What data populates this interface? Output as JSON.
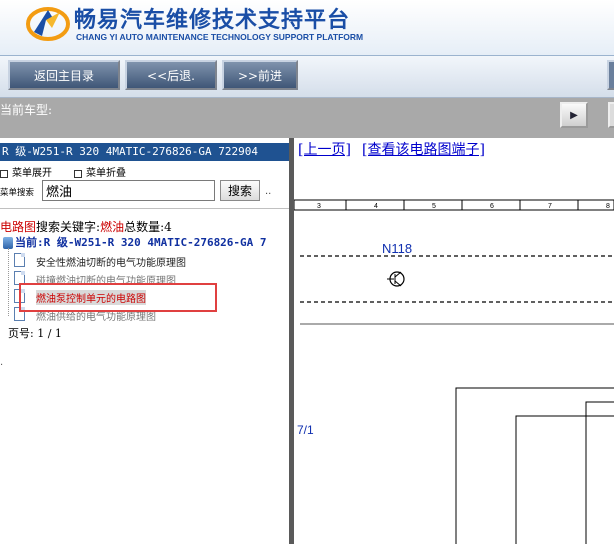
{
  "header": {
    "title_cn": "畅易汽车维修技术支持平台",
    "title_en": "CHANG YI AUTO MAINTENANCE TECHNOLOGY SUPPORT PLATFORM"
  },
  "toolbar": {
    "main_menu": "返回主目录",
    "back": "<<后退.",
    "forward": ">>前进"
  },
  "vehicle": {
    "label": "当前车型:"
  },
  "left": {
    "model": "R 级-W251-R 320 4MATIC-276826-GA 722904",
    "expand": "菜单展开",
    "collapse": "菜单折叠",
    "search_label": "菜单搜索",
    "search_value": "燃油",
    "search_button": "搜索",
    "search_more": "..",
    "result_prefix": "电路图",
    "result_mid": "搜索关键字:",
    "result_keyword": "燃油",
    "result_count_label": "总数量:",
    "result_count": "4",
    "tree_root": "当前:R 级-W251-R 320 4MATIC-276826-GA 7",
    "docs": [
      "安全性燃油切断的电气功能原理图",
      "碰撞燃油切断的电气功能原理图",
      "燃油泵控制单元的电路图",
      "燃油供给的电气功能原理图"
    ],
    "page_label": "页号:",
    "page_value": "1 / 1"
  },
  "right": {
    "link_prev": "[上一页]",
    "link_terminal": "[查看该电路图端子]",
    "ruler": [
      "3",
      "4",
      "5",
      "6",
      "7",
      "8"
    ],
    "component": "N118",
    "side_label": "7/1"
  }
}
